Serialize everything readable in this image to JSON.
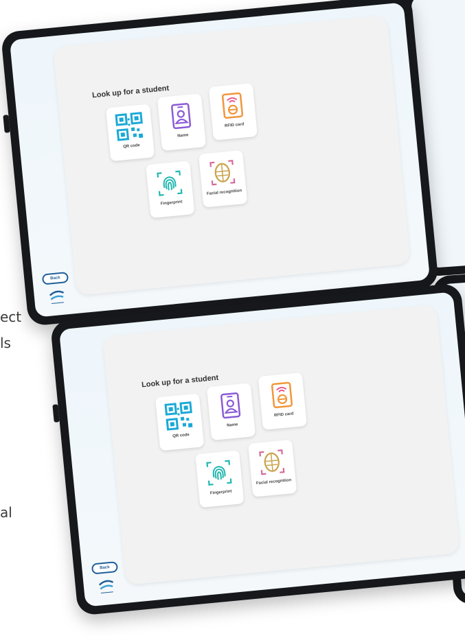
{
  "side_text": [
    "ect",
    "ls",
    "al"
  ],
  "tablets": [
    {
      "title": "Look up for a student",
      "back_label": "Back",
      "cards": [
        {
          "label": "QR code",
          "icon": "qr-code-icon"
        },
        {
          "label": "Name",
          "icon": "person-card-icon"
        },
        {
          "label": "RFID card",
          "icon": "rfid-card-icon"
        },
        {
          "label": "Fingerprint",
          "icon": "fingerprint-icon"
        },
        {
          "label": "Facial recognition",
          "icon": "facial-recognition-icon"
        }
      ]
    },
    {
      "title": "Look up for a student",
      "back_label": "Back",
      "cards": [
        {
          "label": "QR code",
          "icon": "qr-code-icon"
        },
        {
          "label": "Name",
          "icon": "person-card-icon"
        },
        {
          "label": "RFID card",
          "icon": "rfid-card-icon"
        },
        {
          "label": "Fingerprint",
          "icon": "fingerprint-icon"
        },
        {
          "label": "Facial recognition",
          "icon": "facial-recognition-icon"
        }
      ]
    }
  ],
  "colors": {
    "qr": "#1aa9d6",
    "name": "#8a5ad6",
    "rfid": "#f0963a",
    "fingerprint": "#1fb7b0",
    "face": "#c9a24a",
    "back": "#1f5f99"
  }
}
